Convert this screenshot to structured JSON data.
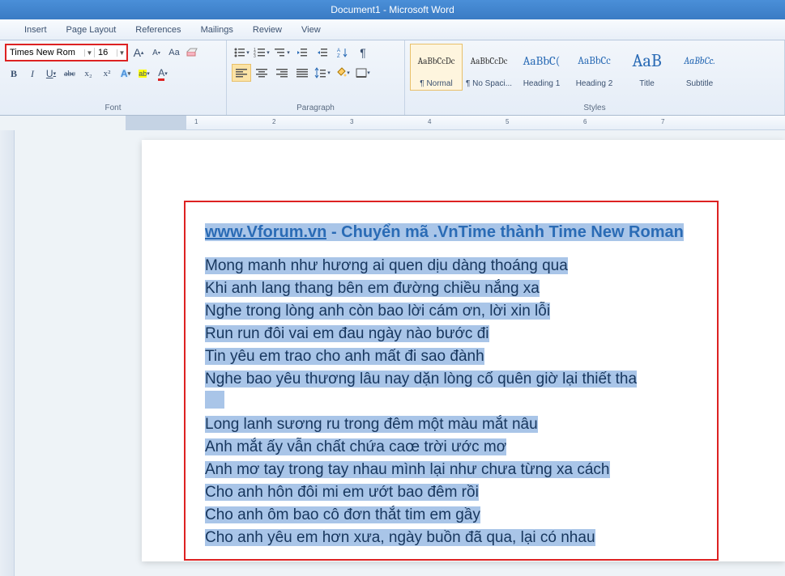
{
  "app": {
    "title": "Document1  -  Microsoft Word"
  },
  "tabs": [
    "Insert",
    "Page Layout",
    "References",
    "Mailings",
    "Review",
    "View"
  ],
  "font": {
    "name": "Times New Rom",
    "size": "16",
    "grow_label": "A",
    "shrink_label": "A",
    "changecase": "Aa",
    "clear": "⌫"
  },
  "formatting": {
    "bold": "B",
    "italic": "I",
    "underline": "U",
    "strike": "abc",
    "sub": "x₂",
    "sup": "x²",
    "effects": "A",
    "highlight": "ab",
    "color": "A"
  },
  "paragraph": {
    "bullets": "•",
    "numbering": "1.",
    "multilevel": "≡",
    "dec_indent": "⇤",
    "inc_indent": "⇥",
    "sort": "A↓",
    "marks": "¶",
    "align_left": "≡",
    "center": "≡",
    "align_right": "≡",
    "justify": "≡",
    "spacing": "↕",
    "shading": "▦",
    "borders": "⊞"
  },
  "styles": [
    {
      "preview": "AaBbCcDc",
      "label": "¶ Normal",
      "size": "11px",
      "color": "#333",
      "active": true
    },
    {
      "preview": "AaBbCcDc",
      "label": "¶ No Spaci...",
      "size": "11px",
      "color": "#333"
    },
    {
      "preview": "AaBbC(",
      "label": "Heading 1",
      "size": "15px",
      "color": "#2a6bb5"
    },
    {
      "preview": "AaBbCc",
      "label": "Heading 2",
      "size": "13px",
      "color": "#2a6bb5"
    },
    {
      "preview": "AaB",
      "label": "Title",
      "size": "22px",
      "color": "#2a6bb5"
    },
    {
      "preview": "AaBbCc.",
      "label": "Subtitle",
      "size": "12px",
      "color": "#2a6bb5",
      "italic": true
    }
  ],
  "group_labels": {
    "font": "Font",
    "paragraph": "Paragraph",
    "styles": "Styles"
  },
  "ruler_marks": [
    "1",
    "2",
    "3",
    "4",
    "5",
    "6",
    "7"
  ],
  "document": {
    "title_link": "www.Vforum.vn",
    "title_rest": "  -  Chuyển  mã  .VnTime  thành  Time  New Roman",
    "p1": [
      "Mong manh như hương ai quen dịu dàng thoáng qua",
      "Khi anh lang thang bên em đường chiều nắng xa",
      "Nghe trong lòng anh còn bao lời cám ơn, lời xin lỗi",
      "Run run đôi vai em đau ngày nào bước đi",
      "Tin yêu em trao cho anh mất đi sao đành",
      "Nghe bao yêu thương lâu nay dặn lòng cố quên giờ lại thiết tha"
    ],
    "p2": [
      "Long lanh sương ru trong đêm một màu mắt nâu",
      "Anh mắt ấy vẫn chất chứa caœ trời ước mơ",
      "Anh mơ tay trong tay nhau mình lại như chưa từng xa cách",
      "Cho anh hôn đôi mi em ướt bao đêm rồi",
      "Cho anh ôm bao cô đơn thắt tim em gầy",
      "Cho anh yêu em hơn xưa, ngày buồn đã qua, lại có nhau"
    ]
  }
}
